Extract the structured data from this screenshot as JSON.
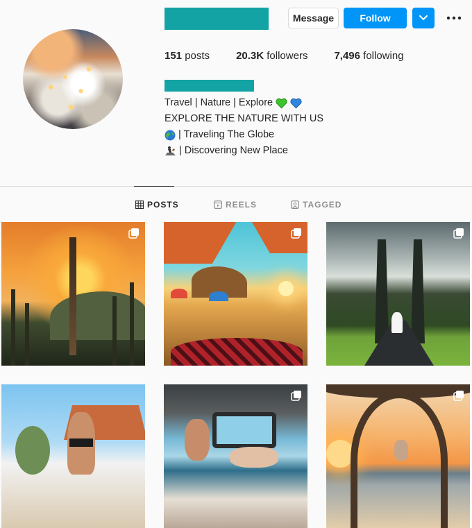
{
  "header": {
    "buttons": {
      "message": "Message",
      "follow": "Follow"
    },
    "stats": {
      "posts_count": "151",
      "posts_label": " posts",
      "followers_count": "20.3K",
      "followers_label": " followers",
      "following_count": "7,496",
      "following_label": " following"
    },
    "bio": {
      "line1": "Travel | Nature | Explore",
      "line2": "EXPLORE THE NATURE WITH US",
      "line3": "| Traveling The Globe",
      "line4": "| Discovering New Place"
    },
    "accent_color": "#0095f6",
    "redaction_color": "#14a3a4"
  },
  "tabs": [
    {
      "label": "POSTS",
      "icon": "grid-icon",
      "active": true
    },
    {
      "label": "REELS",
      "icon": "reels-icon",
      "active": false
    },
    {
      "label": "TAGGED",
      "icon": "tagged-icon",
      "active": false
    }
  ]
}
